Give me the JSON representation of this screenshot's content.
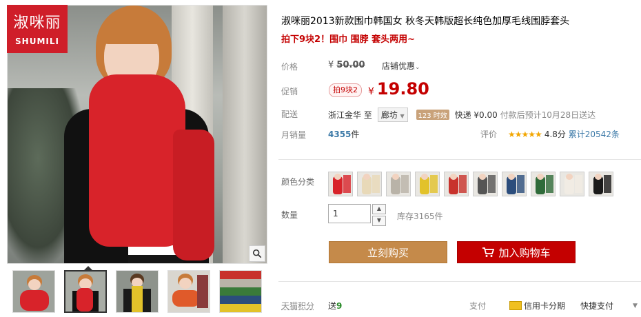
{
  "brand": {
    "logo_cn": "淑咪丽",
    "logo_en": "SHUMILI"
  },
  "product": {
    "title": "淑咪丽2013新款围巾韩国女 秋冬天韩版超长纯色加厚毛线围脖套头",
    "subtitle": "拍下9块2！围巾 围脖 套头两用~"
  },
  "price": {
    "label": "价格",
    "currency": "¥",
    "original": "50.00",
    "shop_promo": "店铺优惠"
  },
  "promo": {
    "label": "促销",
    "tag": "拍9块2",
    "currency": "¥",
    "price": "19.80"
  },
  "shipping": {
    "label": "配送",
    "from": "浙江金华",
    "to_word": "至",
    "destination": "廊坊",
    "badge": "123 时效",
    "fee": "快递 ¥0.00",
    "eta": "付款后预计10月28日送达"
  },
  "sales": {
    "label": "月销量",
    "count": "4355",
    "unit": "件"
  },
  "rating": {
    "label": "评价",
    "stars": "★★★★★",
    "score": "4.8分",
    "reviews": "累计20542条"
  },
  "color": {
    "label": "颜色分类",
    "swatches": [
      {
        "name": "swatch-1",
        "color": "#d8232a"
      },
      {
        "name": "swatch-2",
        "color": "#e8d9b8"
      },
      {
        "name": "swatch-3",
        "color": "#b9b3a8"
      },
      {
        "name": "swatch-4",
        "color": "#e2c22a"
      },
      {
        "name": "swatch-5",
        "color": "#c8322c"
      },
      {
        "name": "swatch-6",
        "color": "#555555"
      },
      {
        "name": "swatch-7",
        "color": "#2b4d7c"
      },
      {
        "name": "swatch-8",
        "color": "#2f6b3a"
      },
      {
        "name": "swatch-9",
        "color": "#f1ece4"
      },
      {
        "name": "swatch-10",
        "color": "#1a1a1a"
      }
    ]
  },
  "quantity": {
    "label": "数量",
    "value": "1",
    "stock": "库存3165件"
  },
  "buttons": {
    "buy_now": "立刻购买",
    "add_to_cart": "加入购物车"
  },
  "footer": {
    "points_label": "天猫积分",
    "points_prefix": "送",
    "points_value": "9",
    "pay_label": "支付",
    "card_installment": "信用卡分期",
    "quick_pay": "快捷支付"
  },
  "gallery": {
    "thumbs": [
      {
        "name": "thumb-1",
        "color": "#d8232a"
      },
      {
        "name": "thumb-2",
        "color": "#d8232a"
      },
      {
        "name": "thumb-3",
        "color": "#e2c22a"
      },
      {
        "name": "thumb-4",
        "color": "#e05a2a"
      },
      {
        "name": "thumb-5",
        "color": "#3a7a3a"
      }
    ]
  },
  "colors": {
    "accent_red": "#c40000",
    "buy_button": "#c58a4a",
    "link_blue": "#3d7aa8"
  }
}
